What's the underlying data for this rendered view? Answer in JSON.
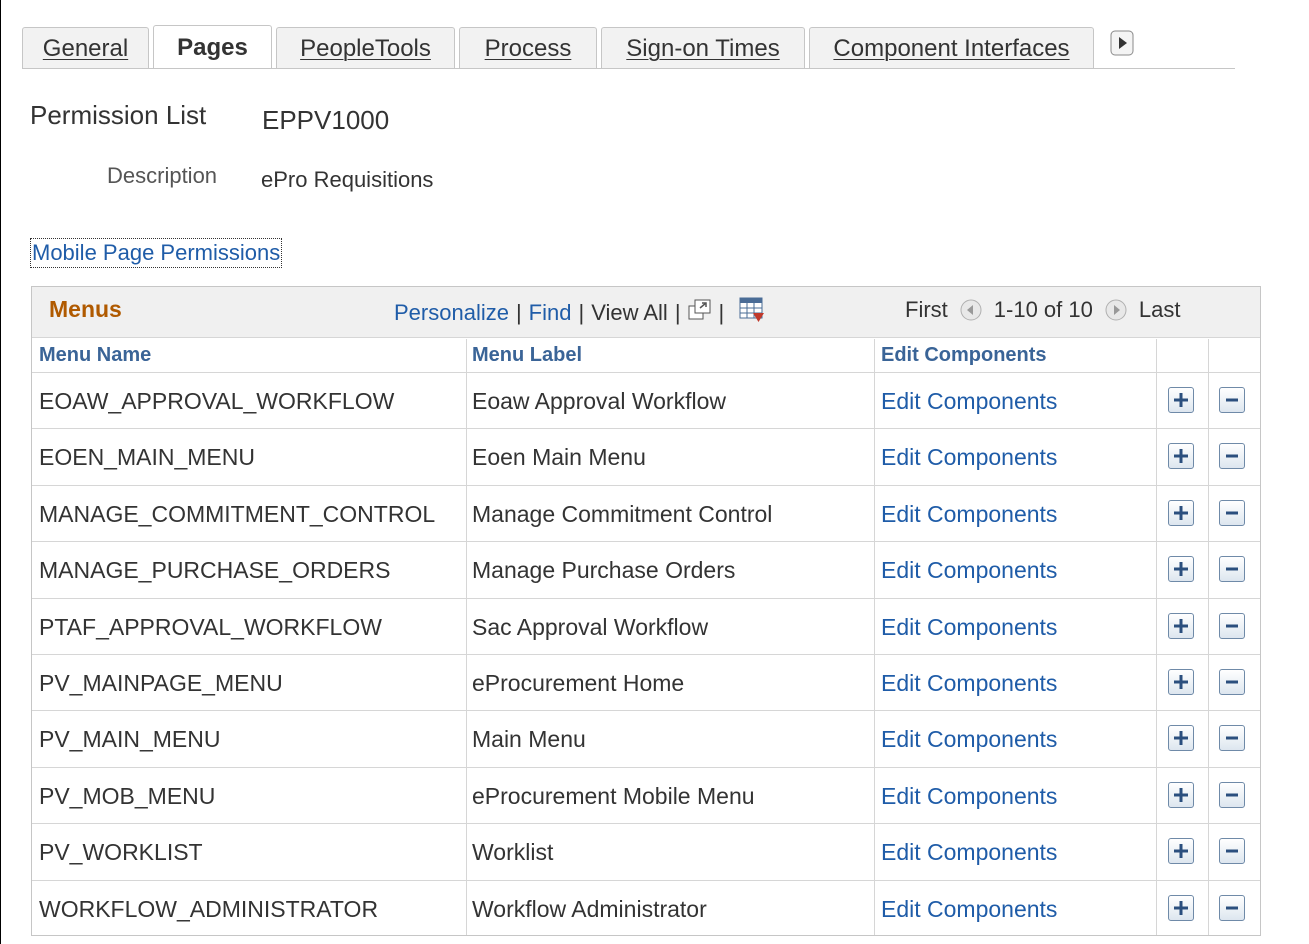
{
  "tabs": [
    {
      "label": "General",
      "active": false
    },
    {
      "label": "Pages",
      "active": true
    },
    {
      "label": "PeopleTools",
      "active": false
    },
    {
      "label": "Process",
      "active": false
    },
    {
      "label": "Sign-on Times",
      "active": false
    },
    {
      "label": "Component Interfaces",
      "active": false
    }
  ],
  "header": {
    "permission_list_label": "Permission List",
    "permission_list_value": "EPPV1000",
    "description_label": "Description",
    "description_value": "ePro Requisitions",
    "mobile_link": "Mobile Page Permissions"
  },
  "grid": {
    "title": "Menus",
    "personalize": "Personalize",
    "find": "Find",
    "view_all": "View All",
    "first": "First",
    "range": "1-10 of 10",
    "last": "Last",
    "columns": [
      "Menu Name",
      "Menu Label",
      "Edit Components"
    ],
    "rows": [
      {
        "name": "EOAW_APPROVAL_WORKFLOW",
        "label": "Eoaw Approval Workflow",
        "edit": "Edit Components"
      },
      {
        "name": "EOEN_MAIN_MENU",
        "label": "Eoen Main Menu",
        "edit": "Edit Components"
      },
      {
        "name": "MANAGE_COMMITMENT_CONTROL",
        "label": "Manage Commitment Control",
        "edit": "Edit Components"
      },
      {
        "name": "MANAGE_PURCHASE_ORDERS",
        "label": "Manage Purchase Orders",
        "edit": "Edit Components"
      },
      {
        "name": "PTAF_APPROVAL_WORKFLOW",
        "label": "Sac Approval Workflow",
        "edit": "Edit Components"
      },
      {
        "name": "PV_MAINPAGE_MENU",
        "label": "eProcurement Home",
        "edit": "Edit Components"
      },
      {
        "name": "PV_MAIN_MENU",
        "label": "Main Menu",
        "edit": "Edit Components"
      },
      {
        "name": "PV_MOB_MENU",
        "label": "eProcurement Mobile Menu",
        "edit": "Edit Components"
      },
      {
        "name": "PV_WORKLIST",
        "label": "Worklist",
        "edit": "Edit Components"
      },
      {
        "name": "WORKFLOW_ADMINISTRATOR",
        "label": "Workflow Administrator",
        "edit": "Edit Components"
      }
    ]
  },
  "colors": {
    "link": "#1f5ca8",
    "grid_title": "#b05a00",
    "column_header": "#3a6497"
  },
  "icons": {
    "tab_scroll": "tab-scroll-right-icon",
    "zoom": "zoom-popup-icon",
    "download": "download-to-spreadsheet-icon",
    "prev": "previous-arrow-icon",
    "next": "next-arrow-icon",
    "add": "add-row-icon",
    "delete": "delete-row-icon"
  }
}
